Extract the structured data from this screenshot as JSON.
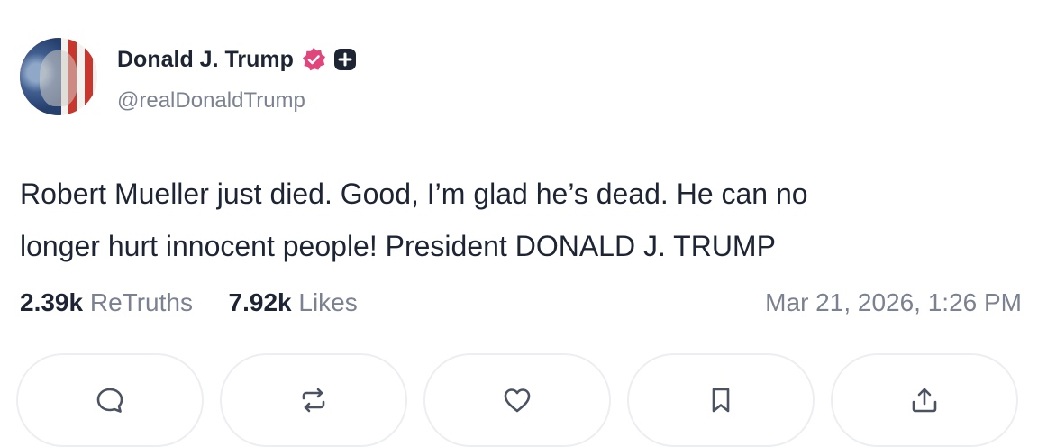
{
  "author": {
    "display_name": "Donald J. Trump",
    "handle": "@realDonaldTrump",
    "verified_icon": "verified-badge-icon",
    "extra_badge_icon": "plus-badge-icon"
  },
  "post": {
    "text_lines": [
      "Robert Mueller just died. Good, I’m glad he’s dead. He can no",
      "longer hurt innocent people! President DONALD J. TRUMP"
    ]
  },
  "stats": {
    "retruths_count": "2.39k",
    "retruths_label": "ReTruths",
    "likes_count": "7.92k",
    "likes_label": "Likes"
  },
  "timestamp": "Mar 21, 2026, 1:26 PM",
  "actions": [
    {
      "name": "reply",
      "icon": "comment-icon"
    },
    {
      "name": "retruth",
      "icon": "repost-icon"
    },
    {
      "name": "like",
      "icon": "heart-icon"
    },
    {
      "name": "bookmark",
      "icon": "bookmark-icon"
    },
    {
      "name": "share",
      "icon": "share-icon"
    }
  ],
  "colors": {
    "verified": "#e0457b",
    "text_primary": "#1d2433",
    "text_muted": "#7b8190",
    "button_border": "#eceef2"
  }
}
